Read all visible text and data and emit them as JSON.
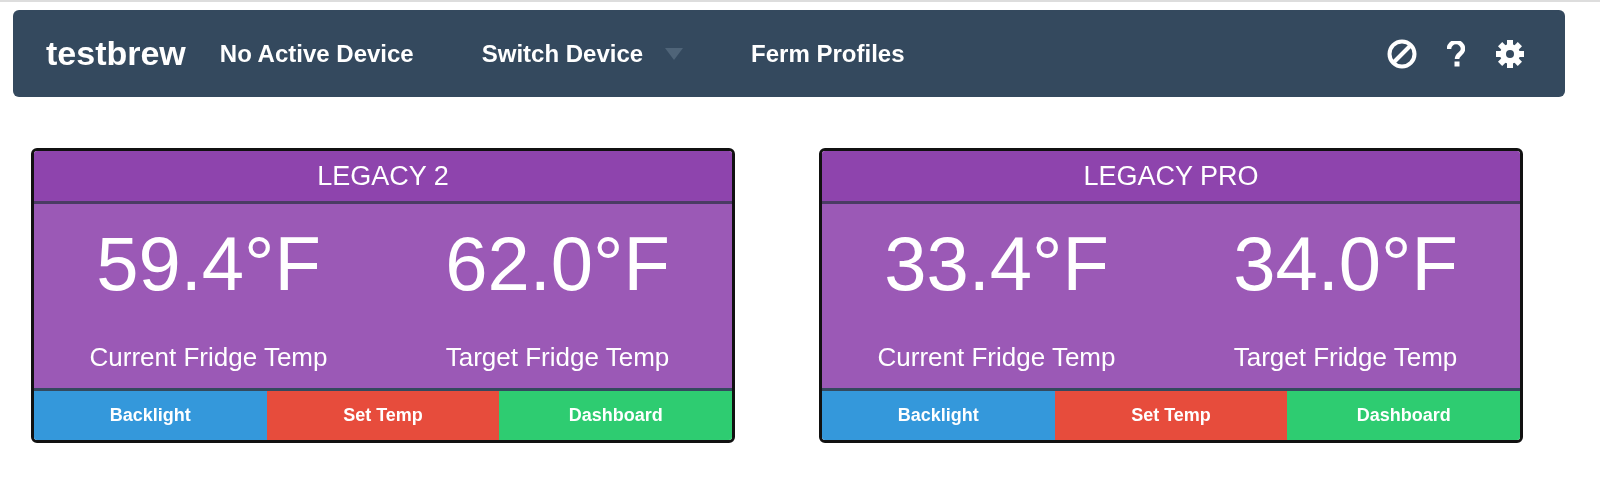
{
  "navbar": {
    "brand": "testbrew",
    "items": [
      {
        "label": "No Active Device",
        "kind": "link"
      },
      {
        "label": "Switch Device",
        "kind": "dropdown"
      },
      {
        "label": "Ferm Profiles",
        "kind": "link"
      }
    ]
  },
  "devices": [
    {
      "name": "LEGACY 2",
      "readings": [
        {
          "value": "59.4°F",
          "label": "Current Fridge Temp"
        },
        {
          "value": "62.0°F",
          "label": "Target Fridge Temp"
        }
      ],
      "buttons": [
        {
          "label": "Backlight",
          "color": "#3498db"
        },
        {
          "label": "Set Temp",
          "color": "#e74c3c"
        },
        {
          "label": "Dashboard",
          "color": "#2ecc71"
        }
      ]
    },
    {
      "name": "LEGACY PRO",
      "readings": [
        {
          "value": "33.4°F",
          "label": "Current Fridge Temp"
        },
        {
          "value": "34.0°F",
          "label": "Target Fridge Temp"
        }
      ],
      "buttons": [
        {
          "label": "Backlight",
          "color": "#3498db"
        },
        {
          "label": "Set Temp",
          "color": "#e74c3c"
        },
        {
          "label": "Dashboard",
          "color": "#2ecc71"
        }
      ]
    }
  ]
}
